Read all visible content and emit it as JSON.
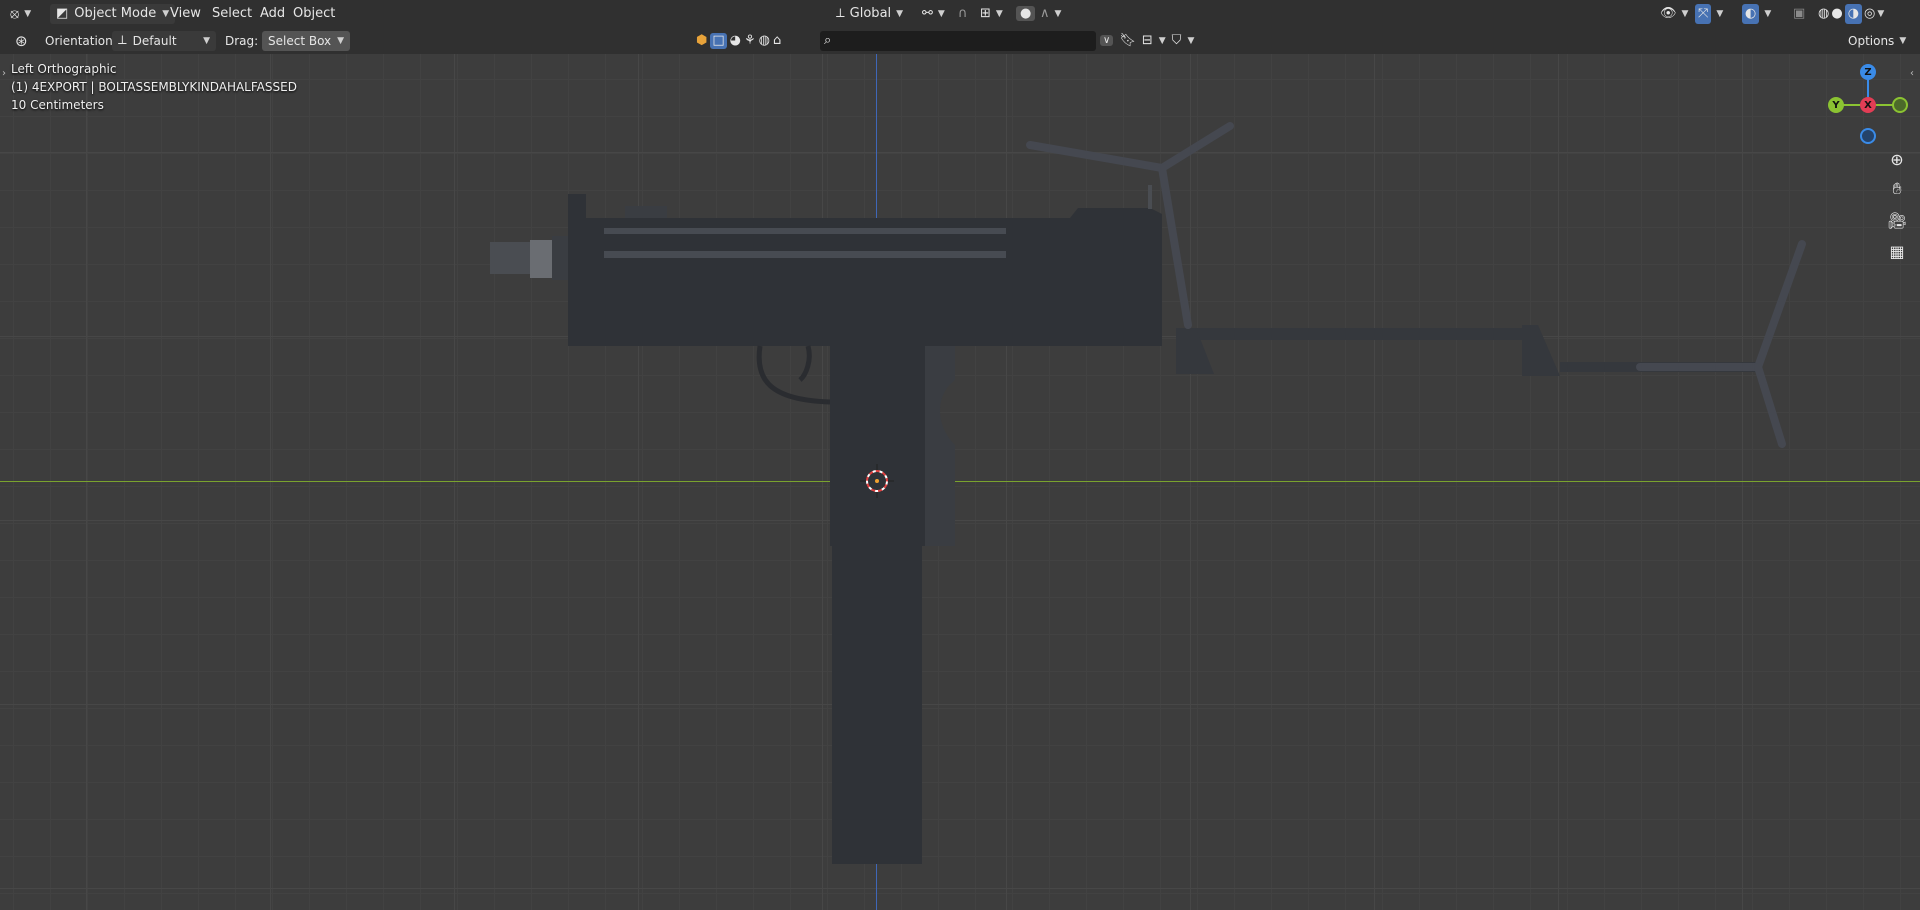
{
  "header": {
    "mode": "Object Mode",
    "menus": [
      "View",
      "Select",
      "Add",
      "Object"
    ],
    "transform_orientation": "Global"
  },
  "tool_settings": {
    "orientation_label": "Orientation:",
    "orientation_value": "Default",
    "drag_label": "Drag:",
    "drag_value": "Select Box",
    "options_label": "Options"
  },
  "search": {
    "value": ""
  },
  "viewport": {
    "view_name": "Left Orthographic",
    "object_label": "(1) 4EXPORT | BOLTASSEMBLYKINDAHALFASSED",
    "grid_scale": "10 Centimeters"
  },
  "gizmo": {
    "z": "Z",
    "y": "Y",
    "x": "X"
  },
  "colors": {
    "accent": "#4772b3",
    "axis_x": "#7aa32e",
    "axis_z": "#3f67b8",
    "gizmo_x": "#e23d55",
    "gizmo_y": "#8bc332",
    "gizmo_z": "#3a8be8"
  },
  "icons": [
    "editor-type-icon",
    "object-mode-icon",
    "transform-pivot-icon",
    "orientation-icon",
    "link-icon",
    "snap-magnet-icon",
    "snap-increment-icon",
    "proportional-edit-icon",
    "falloff-icon",
    "tool-settings-icon",
    "visibility-icon",
    "gizmo-icon",
    "overlay-icon",
    "xray-icon",
    "wireframe-shading-icon",
    "solid-shading-icon",
    "material-shading-icon",
    "rendered-shading-icon",
    "zoom-icon",
    "hand-pan-icon",
    "camera-icon",
    "grid-icon",
    "search-icon",
    "filter-icon",
    "bookmark-icon"
  ]
}
